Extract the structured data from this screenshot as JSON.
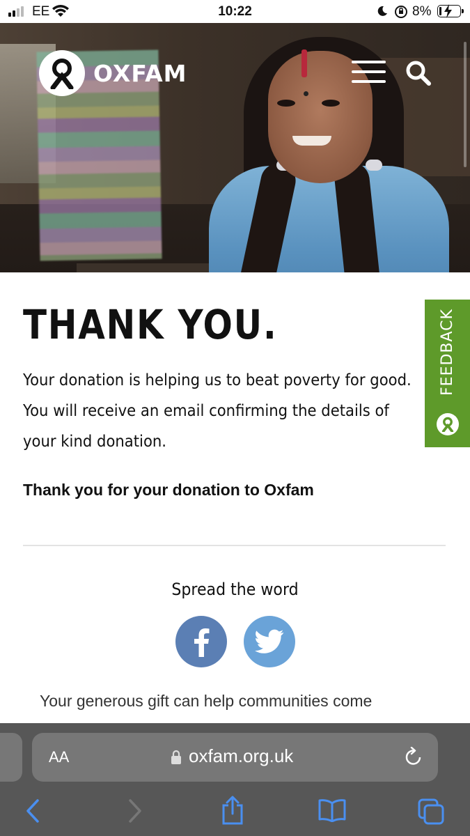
{
  "status_bar": {
    "carrier": "EE",
    "time": "10:22",
    "battery": "8%"
  },
  "header": {
    "brand": "OXFAM"
  },
  "content": {
    "title": "THANK YOU.",
    "message": "Your donation is helping us to beat poverty for good. You will receive an email confirming the details of your kind donation.",
    "thank_you_line": "Thank you for your donation to Oxfam",
    "spread_label": "Spread the word",
    "gift_text": "Your generous gift can help communities come"
  },
  "feedback_tab": {
    "label": "FEEDBACK"
  },
  "browser": {
    "text_size_label": "AA",
    "url": "oxfam.org.uk"
  },
  "colors": {
    "feedback_green": "#5e9a2a",
    "facebook_blue": "#5b7fb4",
    "twitter_blue": "#6aa3d8",
    "safari_accent": "#4a8ff0"
  }
}
